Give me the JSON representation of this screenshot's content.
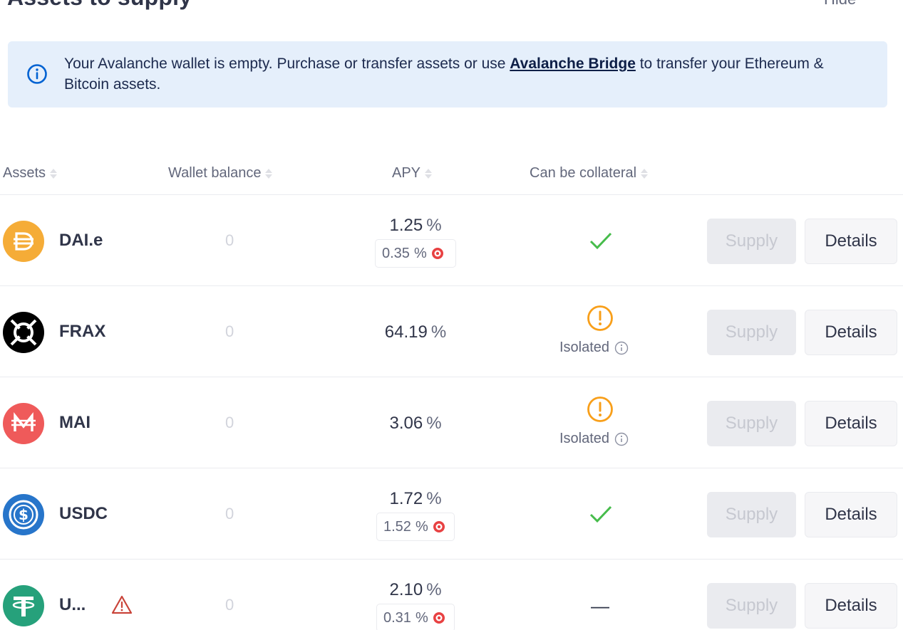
{
  "header": {
    "title": "Assets to supply",
    "hide_label": "Hide"
  },
  "banner": {
    "text_before": "Your Avalanche wallet is empty. Purchase or transfer assets or use ",
    "link_text": "Avalanche Bridge",
    "text_after": " to transfer your Ethereum & Bitcoin assets.",
    "icon": "info-circle-icon"
  },
  "table": {
    "headers": {
      "assets": "Assets",
      "wallet_balance": "Wallet balance",
      "apy": "APY",
      "collateral": "Can be collateral"
    },
    "rows": [
      {
        "symbol": "DAI.e",
        "balance": "0",
        "apy": "1.25",
        "apy_unit": "%",
        "incentive": "0.35",
        "incentive_unit": "%",
        "collateral_label": "",
        "supply_label": "Supply",
        "details_label": "Details",
        "logo_color": "#f5ac37"
      },
      {
        "symbol": "FRAX",
        "balance": "0",
        "apy": "64.19",
        "apy_unit": "%",
        "incentive": "",
        "incentive_unit": "",
        "collateral_label": "Isolated",
        "supply_label": "Supply",
        "details_label": "Details",
        "logo_color": "#000000"
      },
      {
        "symbol": "MAI",
        "balance": "0",
        "apy": "3.06",
        "apy_unit": "%",
        "incentive": "",
        "incentive_unit": "",
        "collateral_label": "Isolated",
        "supply_label": "Supply",
        "details_label": "Details",
        "logo_color": "#ef5a5a"
      },
      {
        "symbol": "USDC",
        "balance": "0",
        "apy": "1.72",
        "apy_unit": "%",
        "incentive": "1.52",
        "incentive_unit": "%",
        "collateral_label": "",
        "supply_label": "Supply",
        "details_label": "Details",
        "logo_color": "#2775ca"
      },
      {
        "symbol": "U...",
        "balance": "0",
        "apy": "2.10",
        "apy_unit": "%",
        "incentive": "0.31",
        "incentive_unit": "%",
        "collateral_label": "—",
        "supply_label": "Supply",
        "details_label": "Details",
        "logo_color": "#26a17b"
      }
    ]
  },
  "colors": {
    "banner_bg": "#e5effb",
    "check_green": "#46bc4b",
    "isolated_orange": "#f89f1a",
    "warning_red": "#bc0000"
  }
}
